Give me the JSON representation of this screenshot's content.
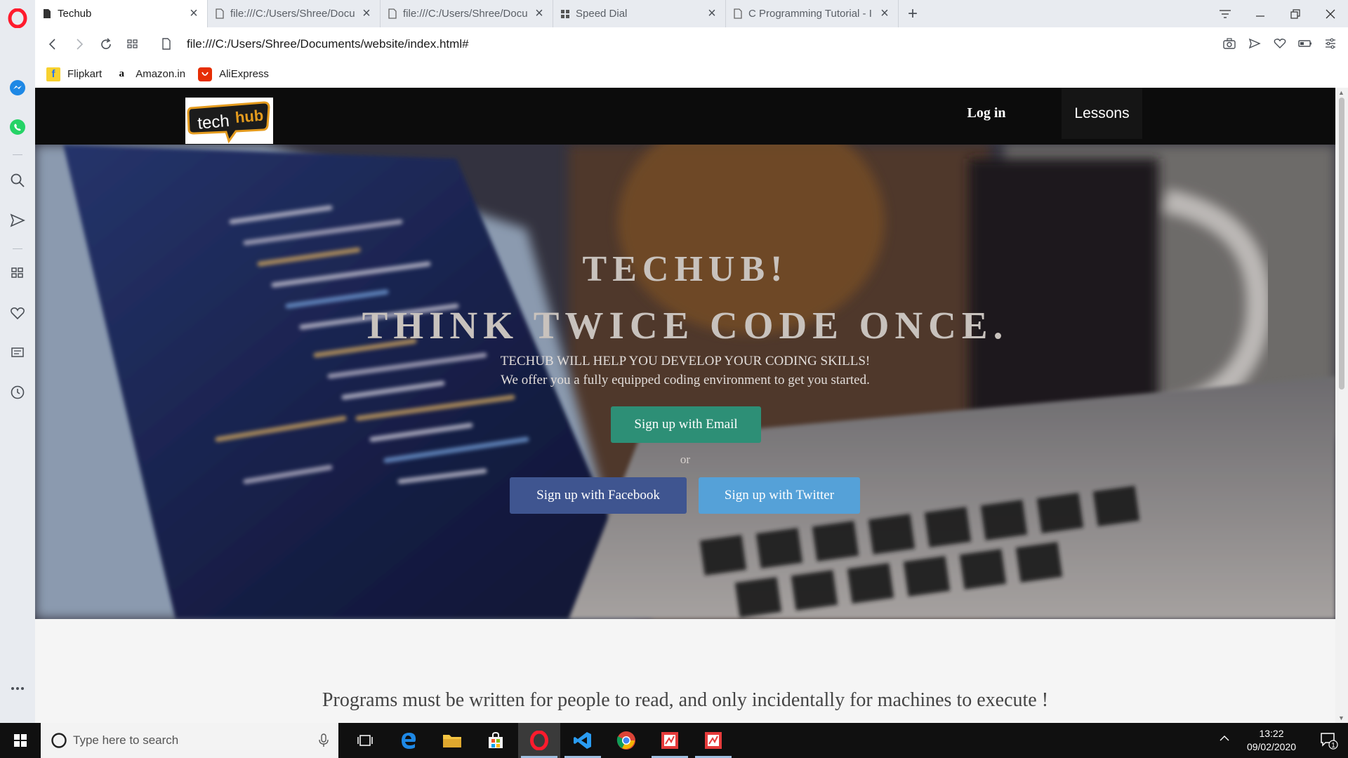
{
  "browser": {
    "tabs": [
      {
        "title": "Techub",
        "active": true
      },
      {
        "title": "file:///C:/Users/Shree/Docu",
        "active": false
      },
      {
        "title": "file:///C:/Users/Shree/Docu",
        "active": false
      },
      {
        "title": "Speed Dial",
        "active": false
      },
      {
        "title": "C Programming Tutorial - I",
        "active": false
      }
    ],
    "url": "file:///C:/Users/Shree/Documents/website/index.html#",
    "bookmarks": [
      {
        "label": "Flipkart",
        "icon": "flipkart-icon"
      },
      {
        "label": "Amazon.in",
        "icon": "amazon-icon"
      },
      {
        "label": "AliExpress",
        "icon": "aliexpress-icon"
      }
    ]
  },
  "site": {
    "logo_text": {
      "tech": "tech",
      "hub": "hub"
    },
    "nav": {
      "login": "Log in",
      "lessons": "Lessons"
    },
    "hero": {
      "title_line1": "TECHUB!",
      "title_line2": "THINK TWICE CODE ONCE.",
      "subtitle_line1": "TECHUB WILL HELP YOU DEVELOP YOUR CODING SKILLS!",
      "subtitle_line2": "We offer you a fully equipped coding environment to get you started.",
      "signup_email": "Sign up with Email",
      "or": "or",
      "signup_facebook": "Sign up with Facebook",
      "signup_twitter": "Sign up with Twitter"
    },
    "quote": "Programs must be written for people to read, and only incidentally for machines to execute !"
  },
  "taskbar": {
    "search_placeholder": "Type here to search",
    "time": "13:22",
    "date": "09/02/2020",
    "notification_count": "1"
  },
  "colors": {
    "email_button": "#2d8f76",
    "facebook_button": "#3f5590",
    "twitter_button": "#55a1d8",
    "nav_background": "#0c0c0c",
    "opera_red": "#ff1b2d"
  }
}
